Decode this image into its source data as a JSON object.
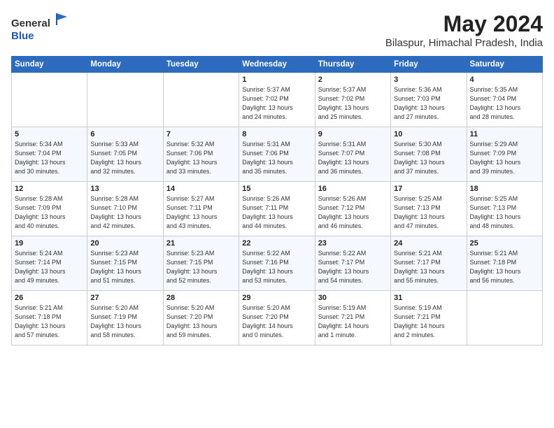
{
  "logo": {
    "text_general": "General",
    "text_blue": "Blue"
  },
  "header": {
    "month_year": "May 2024",
    "location": "Bilaspur, Himachal Pradesh, India"
  },
  "weekdays": [
    "Sunday",
    "Monday",
    "Tuesday",
    "Wednesday",
    "Thursday",
    "Friday",
    "Saturday"
  ],
  "weeks": [
    [
      {
        "day": "",
        "info": ""
      },
      {
        "day": "",
        "info": ""
      },
      {
        "day": "",
        "info": ""
      },
      {
        "day": "1",
        "info": "Sunrise: 5:37 AM\nSunset: 7:02 PM\nDaylight: 13 hours\nand 24 minutes."
      },
      {
        "day": "2",
        "info": "Sunrise: 5:37 AM\nSunset: 7:02 PM\nDaylight: 13 hours\nand 25 minutes."
      },
      {
        "day": "3",
        "info": "Sunrise: 5:36 AM\nSunset: 7:03 PM\nDaylight: 13 hours\nand 27 minutes."
      },
      {
        "day": "4",
        "info": "Sunrise: 5:35 AM\nSunset: 7:04 PM\nDaylight: 13 hours\nand 28 minutes."
      }
    ],
    [
      {
        "day": "5",
        "info": "Sunrise: 5:34 AM\nSunset: 7:04 PM\nDaylight: 13 hours\nand 30 minutes."
      },
      {
        "day": "6",
        "info": "Sunrise: 5:33 AM\nSunset: 7:05 PM\nDaylight: 13 hours\nand 32 minutes."
      },
      {
        "day": "7",
        "info": "Sunrise: 5:32 AM\nSunset: 7:06 PM\nDaylight: 13 hours\nand 33 minutes."
      },
      {
        "day": "8",
        "info": "Sunrise: 5:31 AM\nSunset: 7:06 PM\nDaylight: 13 hours\nand 35 minutes."
      },
      {
        "day": "9",
        "info": "Sunrise: 5:31 AM\nSunset: 7:07 PM\nDaylight: 13 hours\nand 36 minutes."
      },
      {
        "day": "10",
        "info": "Sunrise: 5:30 AM\nSunset: 7:08 PM\nDaylight: 13 hours\nand 37 minutes."
      },
      {
        "day": "11",
        "info": "Sunrise: 5:29 AM\nSunset: 7:09 PM\nDaylight: 13 hours\nand 39 minutes."
      }
    ],
    [
      {
        "day": "12",
        "info": "Sunrise: 5:28 AM\nSunset: 7:09 PM\nDaylight: 13 hours\nand 40 minutes."
      },
      {
        "day": "13",
        "info": "Sunrise: 5:28 AM\nSunset: 7:10 PM\nDaylight: 13 hours\nand 42 minutes."
      },
      {
        "day": "14",
        "info": "Sunrise: 5:27 AM\nSunset: 7:11 PM\nDaylight: 13 hours\nand 43 minutes."
      },
      {
        "day": "15",
        "info": "Sunrise: 5:26 AM\nSunset: 7:11 PM\nDaylight: 13 hours\nand 44 minutes."
      },
      {
        "day": "16",
        "info": "Sunrise: 5:26 AM\nSunset: 7:12 PM\nDaylight: 13 hours\nand 46 minutes."
      },
      {
        "day": "17",
        "info": "Sunrise: 5:25 AM\nSunset: 7:13 PM\nDaylight: 13 hours\nand 47 minutes."
      },
      {
        "day": "18",
        "info": "Sunrise: 5:25 AM\nSunset: 7:13 PM\nDaylight: 13 hours\nand 48 minutes."
      }
    ],
    [
      {
        "day": "19",
        "info": "Sunrise: 5:24 AM\nSunset: 7:14 PM\nDaylight: 13 hours\nand 49 minutes."
      },
      {
        "day": "20",
        "info": "Sunrise: 5:23 AM\nSunset: 7:15 PM\nDaylight: 13 hours\nand 51 minutes."
      },
      {
        "day": "21",
        "info": "Sunrise: 5:23 AM\nSunset: 7:15 PM\nDaylight: 13 hours\nand 52 minutes."
      },
      {
        "day": "22",
        "info": "Sunrise: 5:22 AM\nSunset: 7:16 PM\nDaylight: 13 hours\nand 53 minutes."
      },
      {
        "day": "23",
        "info": "Sunrise: 5:22 AM\nSunset: 7:17 PM\nDaylight: 13 hours\nand 54 minutes."
      },
      {
        "day": "24",
        "info": "Sunrise: 5:21 AM\nSunset: 7:17 PM\nDaylight: 13 hours\nand 55 minutes."
      },
      {
        "day": "25",
        "info": "Sunrise: 5:21 AM\nSunset: 7:18 PM\nDaylight: 13 hours\nand 56 minutes."
      }
    ],
    [
      {
        "day": "26",
        "info": "Sunrise: 5:21 AM\nSunset: 7:18 PM\nDaylight: 13 hours\nand 57 minutes."
      },
      {
        "day": "27",
        "info": "Sunrise: 5:20 AM\nSunset: 7:19 PM\nDaylight: 13 hours\nand 58 minutes."
      },
      {
        "day": "28",
        "info": "Sunrise: 5:20 AM\nSunset: 7:20 PM\nDaylight: 13 hours\nand 59 minutes."
      },
      {
        "day": "29",
        "info": "Sunrise: 5:20 AM\nSunset: 7:20 PM\nDaylight: 14 hours\nand 0 minutes."
      },
      {
        "day": "30",
        "info": "Sunrise: 5:19 AM\nSunset: 7:21 PM\nDaylight: 14 hours\nand 1 minute."
      },
      {
        "day": "31",
        "info": "Sunrise: 5:19 AM\nSunset: 7:21 PM\nDaylight: 14 hours\nand 2 minutes."
      },
      {
        "day": "",
        "info": ""
      }
    ]
  ]
}
